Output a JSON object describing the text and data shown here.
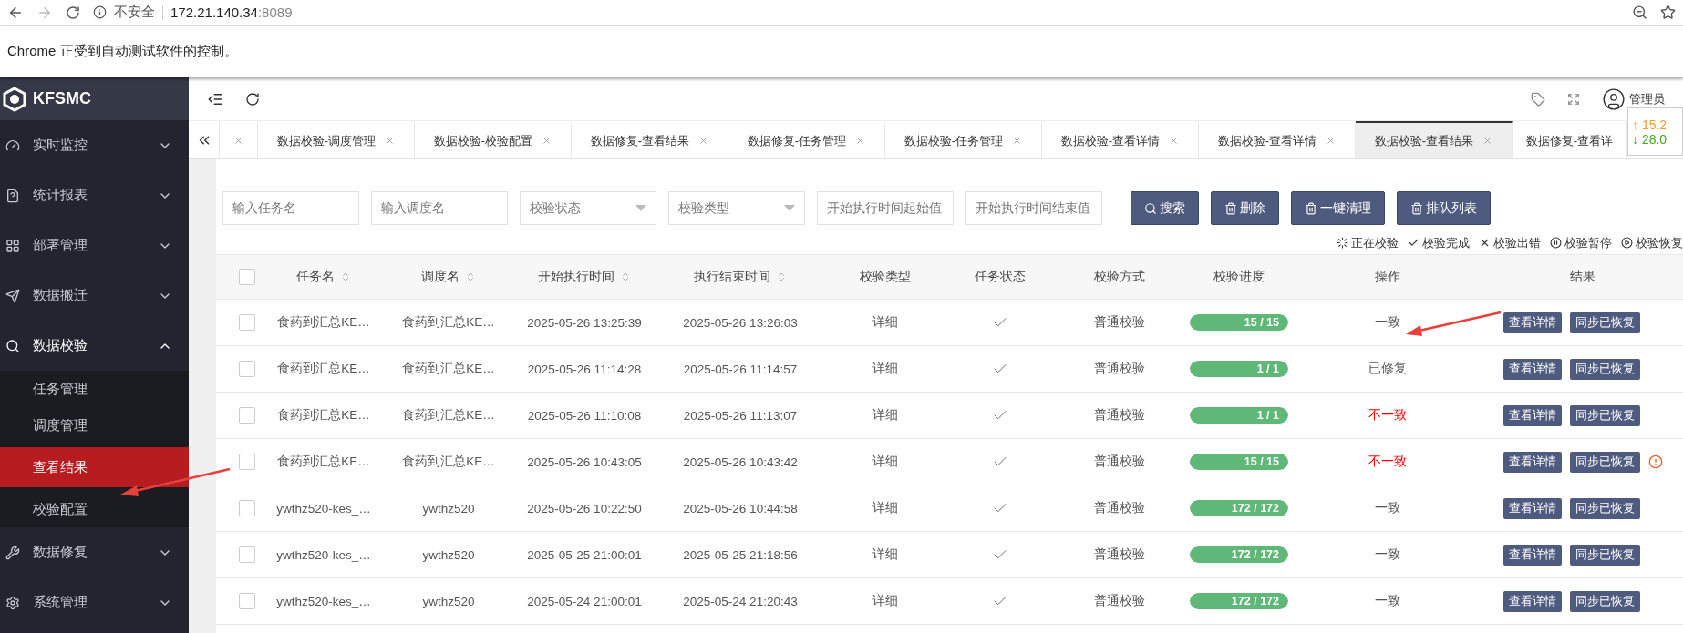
{
  "browser": {
    "security": "不安全",
    "url_host": "172.21.140.34",
    "url_port": ":8089"
  },
  "automation_notice": "Chrome 正受到自动测试软件的控制。",
  "app": {
    "logo": "KFSMC"
  },
  "sidebar": {
    "items": [
      {
        "label": "实时监控",
        "expanded": false
      },
      {
        "label": "统计报表",
        "expanded": false
      },
      {
        "label": "部署管理",
        "expanded": false
      },
      {
        "label": "数据搬迁",
        "expanded": false
      },
      {
        "label": "数据校验",
        "expanded": true,
        "children": [
          {
            "label": "任务管理",
            "selected": false
          },
          {
            "label": "调度管理",
            "selected": false
          },
          {
            "label": "查看结果",
            "selected": true
          },
          {
            "label": "校验配置",
            "selected": false
          }
        ]
      },
      {
        "label": "数据修复",
        "expanded": false
      },
      {
        "label": "系统管理",
        "expanded": false
      }
    ]
  },
  "header": {
    "user": "管理员",
    "net_up": "↑ 15.2",
    "net_down": "↓ 28.0"
  },
  "tabs": [
    {
      "selected": false
    },
    {
      "label": "数据校验-调度管理",
      "selected": false
    },
    {
      "label": "数据校验-校验配置",
      "selected": false
    },
    {
      "label": "数据修复-查看结果",
      "selected": false
    },
    {
      "label": "数据修复-任务管理",
      "selected": false
    },
    {
      "label": "数据校验-任务管理",
      "selected": false
    },
    {
      "label": "数据校验-查看详情",
      "selected": false
    },
    {
      "label": "数据校验-查看详情",
      "selected": false
    },
    {
      "label": "数据校验-查看结果",
      "selected": true
    },
    {
      "label": "数据修复-查看详",
      "selected": false,
      "closable": false
    }
  ],
  "filters": [
    {
      "kind": "input",
      "placeholder": "输入任务名"
    },
    {
      "kind": "input",
      "placeholder": "输入调度名"
    },
    {
      "kind": "select",
      "placeholder": "校验状态"
    },
    {
      "kind": "select",
      "placeholder": "校验类型"
    },
    {
      "kind": "input",
      "placeholder": "开始执行时间起始值"
    },
    {
      "kind": "input",
      "placeholder": "开始执行时间结束值"
    }
  ],
  "actions": [
    {
      "kind": "search",
      "label": "搜索"
    },
    {
      "kind": "trash",
      "label": "删除"
    },
    {
      "kind": "trash",
      "label": "一键清理"
    },
    {
      "kind": "trash",
      "label": "排队列表"
    }
  ],
  "legend": [
    {
      "kind": "running",
      "label": "正在校验"
    },
    {
      "kind": "done",
      "label": "校验完成"
    },
    {
      "kind": "error",
      "label": "校验出错"
    },
    {
      "kind": "paused",
      "label": "校验暂停"
    },
    {
      "kind": "resume",
      "label": "校验恢复"
    }
  ],
  "table": {
    "all_checked": false,
    "columns": [
      {
        "label": "任务名",
        "sortable": true
      },
      {
        "label": "调度名",
        "sortable": true
      },
      {
        "label": "开始执行时间",
        "sortable": true
      },
      {
        "label": "执行结束时间",
        "sortable": true
      },
      {
        "label": "校验类型",
        "sortable": false
      },
      {
        "label": "任务状态",
        "sortable": false
      },
      {
        "label": "校验方式",
        "sortable": false
      },
      {
        "label": "校验进度",
        "sortable": false
      },
      {
        "label": "操作",
        "sortable": false
      },
      {
        "label": "结果",
        "sortable": false
      }
    ],
    "rows": [
      {
        "checked": false,
        "task": "食药到汇总KE…",
        "schedule": "食药到汇总KE…",
        "start": "2025-05-26 13:25:39",
        "end": "2025-05-26 13:26:03",
        "type": "详细",
        "done": true,
        "method": "普通校验",
        "level": 1,
        "progress": "15 / 15",
        "outcome": "一致",
        "mismatch": false,
        "warning": false,
        "buttons": [
          "查看详情",
          "同步已恢复"
        ]
      },
      {
        "checked": false,
        "task": "食药到汇总KE…",
        "schedule": "食药到汇总KE…",
        "start": "2025-05-26 11:14:28",
        "end": "2025-05-26 11:14:57",
        "type": "详细",
        "done": true,
        "method": "普通校验",
        "level": 1,
        "progress": "1 / 1",
        "outcome": "已修复",
        "mismatch": false,
        "warning": false,
        "buttons": [
          "查看详情",
          "同步已恢复"
        ]
      },
      {
        "checked": false,
        "task": "食药到汇总KE…",
        "schedule": "食药到汇总KE…",
        "start": "2025-05-26 11:10:08",
        "end": "2025-05-26 11:13:07",
        "type": "详细",
        "done": true,
        "method": "普通校验",
        "level": 1,
        "progress": "1 / 1",
        "outcome": "不一致",
        "mismatch": true,
        "warning": false,
        "buttons": [
          "查看详情",
          "同步已恢复"
        ]
      },
      {
        "checked": false,
        "task": "食药到汇总KE…",
        "schedule": "食药到汇总KE…",
        "start": "2025-05-26 10:43:05",
        "end": "2025-05-26 10:43:42",
        "type": "详细",
        "done": true,
        "method": "普通校验",
        "level": 1,
        "progress": "15 / 15",
        "outcome": "不一致",
        "mismatch": true,
        "warning": true,
        "buttons": [
          "查看详情",
          "同步已恢复"
        ]
      },
      {
        "checked": false,
        "task": "ywthz520-kes_…",
        "schedule": "ywthz520",
        "start": "2025-05-26 10:22:50",
        "end": "2025-05-26 10:44:58",
        "type": "详细",
        "done": true,
        "method": "普通校验",
        "level": 1,
        "progress": "172 / 172",
        "outcome": "一致",
        "mismatch": false,
        "warning": false,
        "buttons": [
          "查看详情",
          "同步已恢复"
        ]
      },
      {
        "checked": false,
        "task": "ywthz520-kes_…",
        "schedule": "ywthz520",
        "start": "2025-05-25 21:00:01",
        "end": "2025-05-25 21:18:56",
        "type": "详细",
        "done": true,
        "method": "普通校验",
        "level": 1,
        "progress": "172 / 172",
        "outcome": "一致",
        "mismatch": false,
        "warning": false,
        "buttons": [
          "查看详情",
          "同步已恢复"
        ]
      },
      {
        "checked": false,
        "task": "ywthz520-kes_…",
        "schedule": "ywthz520",
        "start": "2025-05-24 21:00:01",
        "end": "2025-05-24 21:20:43",
        "type": "详细",
        "done": true,
        "method": "普通校验",
        "level": 1,
        "progress": "172 / 172",
        "outcome": "一致",
        "mismatch": false,
        "warning": false,
        "buttons": [
          "查看详情",
          "同步已恢复"
        ]
      }
    ]
  }
}
